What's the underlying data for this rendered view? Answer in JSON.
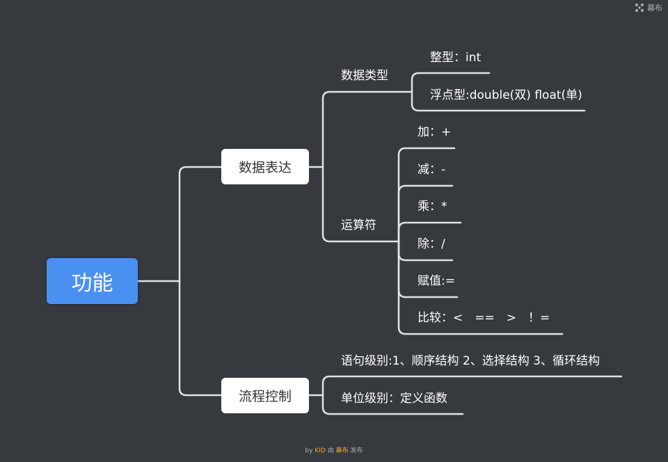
{
  "brand": {
    "name": "幕布",
    "icon": "mubu-logo-icon"
  },
  "root": {
    "label": "功能"
  },
  "branches": {
    "data_expression": {
      "label": "数据表达",
      "data_types": {
        "label": "数据类型",
        "items": [
          "整型：int",
          "浮点型:double(双) float(单)"
        ]
      },
      "operators": {
        "label": "运算符",
        "items": [
          "加：+",
          "减：-",
          "乘：*",
          "除：/",
          "赋值:=",
          "比较：<　==　>　！="
        ]
      }
    },
    "flow_control": {
      "label": "流程控制",
      "items": [
        "语句级别:1、顺序结构 2、选择结构 3、循环结构",
        "单位级别：定义函数"
      ]
    }
  },
  "footer": {
    "by": "by",
    "author": "KID",
    "via": "由",
    "brand": "幕布",
    "publish": "发布"
  },
  "colors": {
    "background": "#363a3f",
    "line": "#dfe3e6",
    "root": "#4a90f0",
    "node": "#ffffff"
  }
}
